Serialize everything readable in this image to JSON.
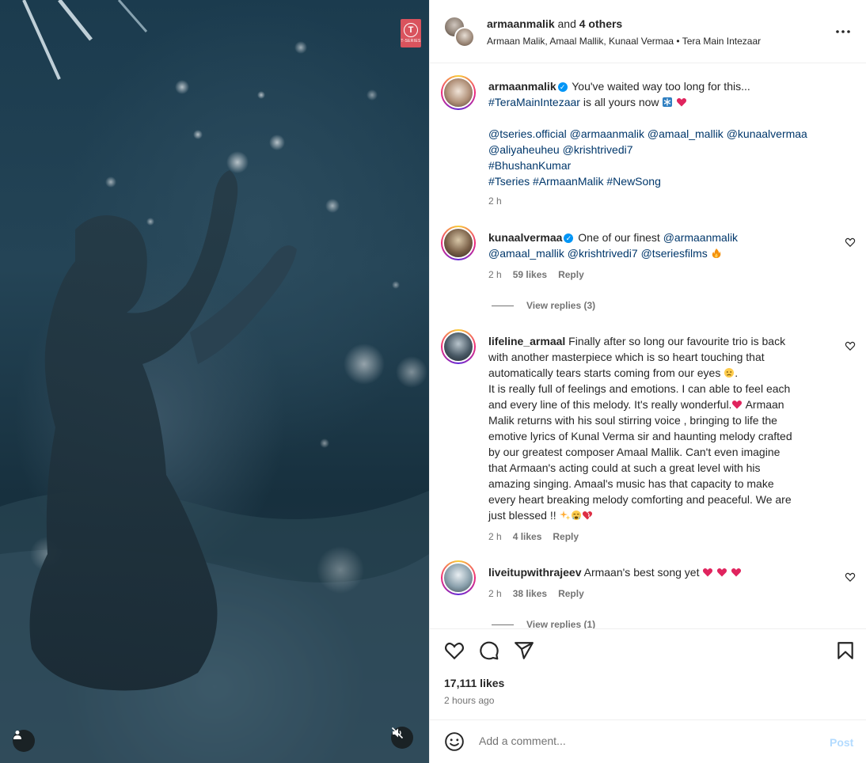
{
  "header": {
    "username": "armaanmalik",
    "and_text": " and ",
    "others": "4 others",
    "subtitle": "Armaan Malik, Amaal Mallik, Kunaal Vermaa • Tera Main Intezaar",
    "more_icon": "more-horizontal-icon"
  },
  "media": {
    "logo_letter": "T",
    "logo_text": "T-SERIES"
  },
  "caption": {
    "username": "armaanmalik",
    "line1": "You've waited way too long for this...",
    "line2_tag": "#TeraMainIntezaar",
    "line2_text": " is all yours now ",
    "mentions1": "@tseries.official @armaanmalik @amaal_mallik @kunaalvermaa",
    "mentions2": "@aliyaheuheu @krishtrivedi7",
    "tags1": "#BhushanKumar",
    "tags2": "#Tseries #ArmaanMalik #NewSong",
    "time": "2 h"
  },
  "comments": [
    {
      "username": "kunaalvermaa",
      "line1": "One of our finest ",
      "mention1": "@armaanmalik",
      "mentions2": "@amaal_mallik @krishtrivedi7 @tseriesfilms",
      "time": "2 h",
      "likes": "59 likes",
      "reply": "Reply",
      "view_replies": "View replies (3)"
    },
    {
      "username": "lifeline_armaal",
      "l1": "Finally after so long our favourite trio is back",
      "l2": "with another masterpiece which is so heart touching that",
      "l3": "automatically tears starts coming from our eyes ",
      "l4": "It is really full of feelings and emotions. I can able to feel each",
      "l5": "and every line of this melody. It's really wonderful.",
      "l5b": " Armaan",
      "l6": "Malik returns with his soul stirring voice , bringing to life the",
      "l7": "emotive lyrics of Kunal Verma sir and haunting melody crafted",
      "l8": "by our greatest composer Amaal Mallik. Can't even imagine",
      "l9": "that Armaan's acting could at such a great level with his",
      "l10": "amazing singing. Amaal's music has that capacity to make",
      "l11": "every heart breaking melody comforting and peaceful. We are",
      "l12": "just blessed !! ",
      "time": "2 h",
      "likes": "4 likes",
      "reply": "Reply"
    },
    {
      "username": "liveitupwithrajeev",
      "text": "Armaan's best song yet ",
      "time": "2 h",
      "likes": "38 likes",
      "reply": "Reply",
      "view_replies": "View replies (1)"
    }
  ],
  "footer": {
    "likes": "17,111 likes",
    "time": "2 hours ago",
    "comment_placeholder": "Add a comment...",
    "post": "Post"
  },
  "colors": {
    "link": "#00376b",
    "verified": "#0095f6",
    "post_disabled": "#b3dbff",
    "muted": "#737373"
  }
}
